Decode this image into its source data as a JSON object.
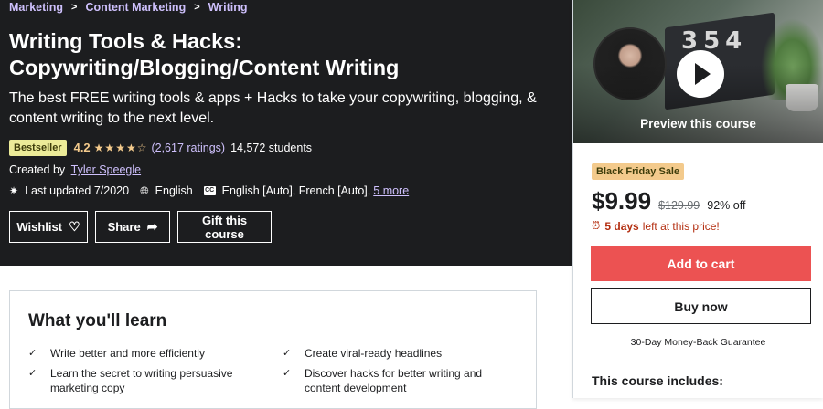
{
  "breadcrumb": [
    "Marketing",
    "Content Marketing",
    "Writing"
  ],
  "course": {
    "title": "Writing Tools & Hacks: Copywriting/Blogging/Content Writing",
    "subtitle": "The best FREE writing tools & apps + Hacks to take your copywriting, blogging, & content writing to the next level.",
    "badge": "Bestseller",
    "rating": "4.2",
    "stars_icon": "star-rating-icon",
    "stars_glyphs": "★★★★☆",
    "ratings_count": "(2,617 ratings)",
    "students": "14,572 students",
    "created_by_label": "Created by",
    "instructor": "Tyler Speegle",
    "last_updated": "Last updated 7/2020",
    "language": "English",
    "captions": "English [Auto], French [Auto],",
    "more_link": "5 more"
  },
  "actions": {
    "wishlist": "Wishlist",
    "share": "Share",
    "gift": "Gift this course"
  },
  "sidebar": {
    "preview_label": "Preview this course",
    "sale_badge": "Black Friday Sale",
    "price": "$9.99",
    "original_price": "$129.99",
    "discount": "92% off",
    "timer_days": "5 days",
    "timer_rest": "left at this price!",
    "add_to_cart": "Add to cart",
    "buy_now": "Buy now",
    "guarantee": "30-Day Money-Back Guarantee",
    "includes_title": "This course includes:"
  },
  "learn": {
    "heading": "What you'll learn",
    "items": [
      "Write better and more efficiently",
      "Create viral-ready headlines",
      "Learn the secret to writing persuasive marketing copy",
      "Discover hacks for better writing and content development"
    ]
  },
  "colors": {
    "hero_bg": "#1c1d1f",
    "link_purple": "#cec0fc",
    "star_gold": "#f3ca8c",
    "cart_red": "#ec5252",
    "timer_red": "#b32d0f"
  }
}
